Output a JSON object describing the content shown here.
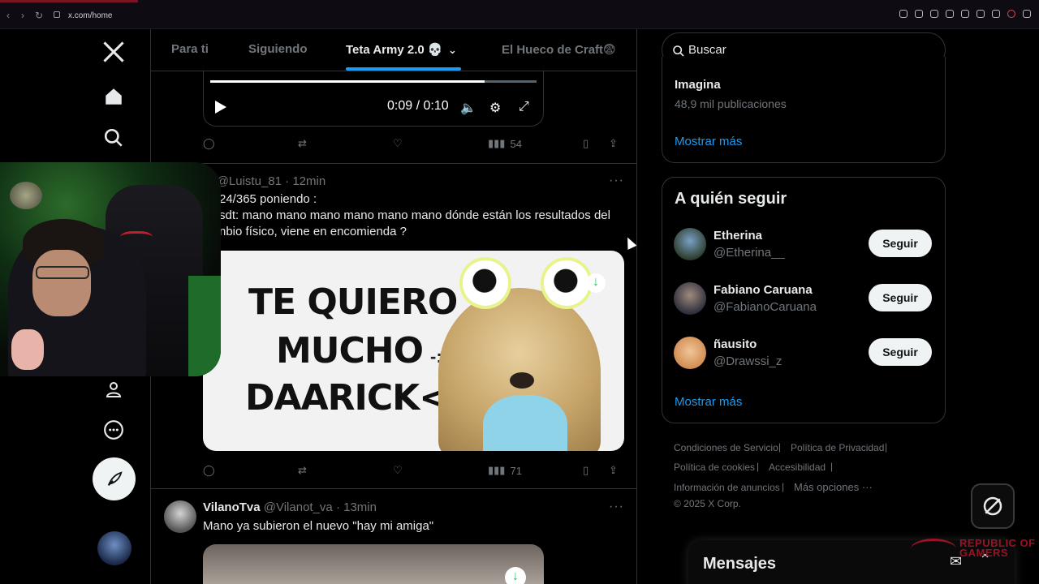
{
  "browser": {
    "url": "x.com/home"
  },
  "tabs": [
    {
      "label": "Para ti"
    },
    {
      "label": "Siguiendo"
    },
    {
      "label": "Teta Army 2.0 💀"
    },
    {
      "label": "El Hueco de Craft😨"
    }
  ],
  "video_post": {
    "time": "0:09 / 0:10",
    "progress": 0.84,
    "views": "54"
  },
  "post1": {
    "name_partial": "is",
    "handle": "@Luistu_81",
    "dot": "·",
    "time": "12min",
    "line1": "24/365 poniendo :",
    "line2": "sdt: mano mano mano mano mano mano dónde están los resultados del",
    "line3": "nbio físico, viene en encomienda ?",
    "image_text": [
      "TE QUIERO",
      "MUCHO",
      "DAARICK<3"
    ],
    "image_squiggle": "-:v",
    "views": "71"
  },
  "post2": {
    "name": "VilanoTva",
    "handle": "@Vilanot_va",
    "dot": "·",
    "time": "13min",
    "text": "Mano ya subieron el nuevo \"hay mi amiga\""
  },
  "search": {
    "placeholder": "Buscar"
  },
  "trends": {
    "item_name": "Imagina",
    "item_count": "48,9 mil publicaciones",
    "show_more": "Mostrar más"
  },
  "who_to_follow": {
    "title": "A quién seguir",
    "users": [
      {
        "name": "Etherina",
        "handle": "@Etherina__",
        "button": "Seguir"
      },
      {
        "name": "Fabiano Caruana",
        "handle": "@FabianoCaruana",
        "button": "Seguir"
      },
      {
        "name": "ñausito",
        "handle": "@Drawssi_z",
        "button": "Seguir"
      }
    ],
    "show_more": "Mostrar más"
  },
  "footer": {
    "terms": "Condiciones de Servicio",
    "privacy": "Política de Privacidad",
    "cookies": "Política de cookies",
    "accessibility": "Accesibilidad",
    "ads": "Información de anuncios",
    "more": "Más opciones ···",
    "copyright": "© 2025 X Corp."
  },
  "messages": {
    "title": "Mensajes"
  },
  "overlay": {
    "brand_line1": "REPUBLIC OF",
    "brand_line2": "GAMERS"
  },
  "colors": {
    "accent": "#1d9bf0",
    "bg": "#000000",
    "border": "#2f3336",
    "muted": "#71767b"
  }
}
